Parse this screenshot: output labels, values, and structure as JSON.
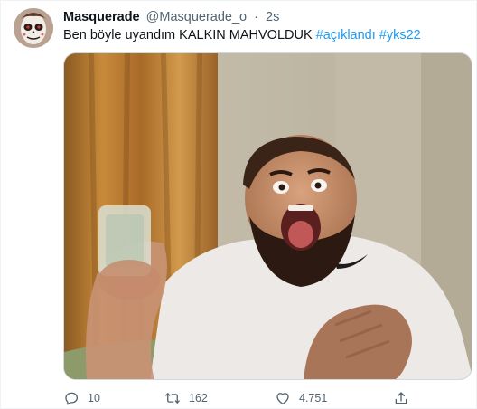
{
  "tweet": {
    "display_name": "Masquerade",
    "handle": "@Masquerade_o",
    "separator": "·",
    "time": "2s",
    "text_plain": "Ben böyle uyandım KALKIN MAHVOLDUK",
    "hashtags": [
      "#açıklandı",
      "#yks22"
    ],
    "hashtag_color": "#1d9bf0"
  },
  "media": {
    "icon": "image-icon"
  },
  "actions": {
    "reply": {
      "icon": "reply-icon",
      "count": "10"
    },
    "retweet": {
      "icon": "retweet-icon",
      "count": "162"
    },
    "like": {
      "icon": "heart-icon",
      "count": "4.751"
    },
    "share": {
      "icon": "share-icon"
    }
  }
}
